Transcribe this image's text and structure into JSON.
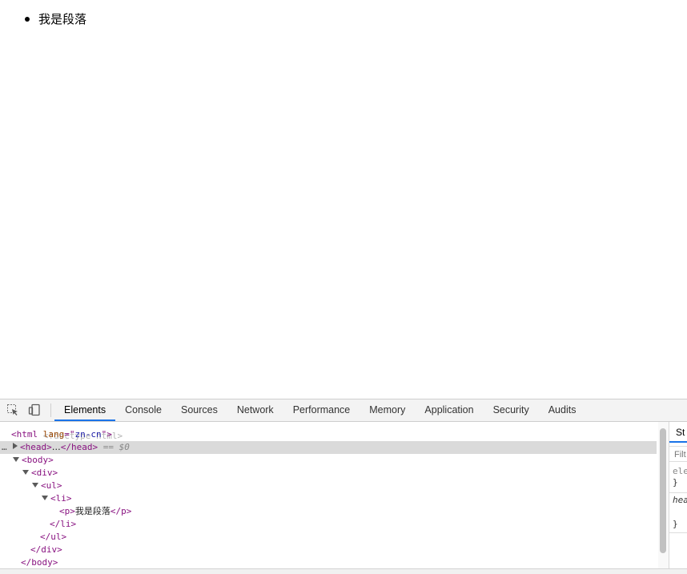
{
  "page": {
    "list_item_text": "我是段落"
  },
  "devtools": {
    "tabs": [
      "Elements",
      "Console",
      "Sources",
      "Network",
      "Performance",
      "Memory",
      "Application",
      "Security",
      "Audits"
    ],
    "active_tab": "Elements",
    "dom": {
      "doctype": "<!doctype html>",
      "html_open_tag": "html",
      "html_attr_name": "lang",
      "html_attr_value": "zn-cn",
      "head_open": "<head>",
      "head_ellipsis": "…",
      "head_close": "</head>",
      "selected_marker": "== $0",
      "body_open": "<body>",
      "div_open": "<div>",
      "ul_open": "<ul>",
      "li_open": "<li>",
      "p_open": "<p>",
      "p_text": "我是段落",
      "p_close": "</p>",
      "li_close": "</li>",
      "ul_close": "</ul>",
      "div_close": "</div>",
      "body_close": "</body>"
    },
    "styles": {
      "tab_label": "St",
      "filter_placeholder": "Filt",
      "rule1_selector": "ele",
      "rule1_close": "}",
      "rule2_selector": "hea",
      "rule2_close": "}"
    },
    "colors": {
      "active_tab_underline": "#1a73e8",
      "tag": "#881280",
      "attribute": "#994500",
      "attribute_value": "#1a1aa6",
      "selected_row": "#dadada"
    },
    "icons": [
      "inspect-element-icon",
      "device-toolbar-icon"
    ]
  }
}
